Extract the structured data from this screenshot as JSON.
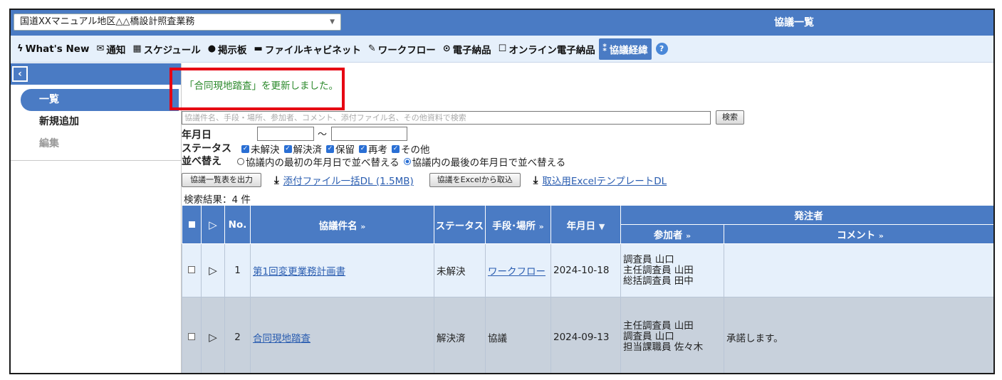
{
  "header": {
    "project_name": "国道XXマニュアル地区△△橋設計照査業務",
    "page_title": "協議一覧"
  },
  "menu": {
    "items": [
      {
        "label": "What's New",
        "icon": "bolt-icon",
        "glyph": "ϟ"
      },
      {
        "label": "通知",
        "icon": "mail-icon",
        "glyph": "✉"
      },
      {
        "label": "スケジュール",
        "icon": "calendar-icon",
        "glyph": "▦"
      },
      {
        "label": "掲示板",
        "icon": "chat-icon",
        "glyph": "●"
      },
      {
        "label": "ファイルキャビネット",
        "icon": "cabinet-icon",
        "glyph": "▬"
      },
      {
        "label": "ワークフロー",
        "icon": "edit-icon",
        "glyph": "✎"
      },
      {
        "label": "電子納品",
        "icon": "disc-icon",
        "glyph": "⊙"
      },
      {
        "label": "オンライン電子納品",
        "icon": "square-icon",
        "glyph": "☐"
      },
      {
        "label": "協議経緯",
        "icon": "people-icon",
        "glyph": "⁑",
        "active": true
      }
    ],
    "help": "?"
  },
  "sidebar": {
    "items": [
      {
        "label": "一覧",
        "state": "active"
      },
      {
        "label": "新規追加",
        "state": "normal"
      },
      {
        "label": "編集",
        "state": "disabled"
      }
    ]
  },
  "flash_message": "「合同現地踏査」を更新しました。",
  "search": {
    "placeholder": "協議件名、手段・場所、参加者、コメント、添付ファイル名、その他資料で検索",
    "button": "検索",
    "date_label": "年月日",
    "date_sep": "～",
    "status_label": "ステータス",
    "statuses": [
      "未解決",
      "解決済",
      "保留",
      "再考",
      "その他"
    ],
    "sort_label": "並べ替え",
    "sort_options": [
      {
        "label": "協議内の最初の年月日で並べ替える",
        "selected": false
      },
      {
        "label": "協議内の最後の年月日で並べ替える",
        "selected": true
      }
    ]
  },
  "actions": {
    "export_button": "協議一覧表を出力",
    "bulk_download": "添付ファイル一括DL (1.5MB)",
    "import_button": "協議をExcelから取込",
    "template_download": "取込用ExcelテンプレートDL"
  },
  "result_count": "検索結果：4 件",
  "table": {
    "headers": {
      "no": "No.",
      "title": "協議件名",
      "status": "ステータス",
      "method": "手段･場所",
      "date": "年月日",
      "orderer": "発注者",
      "participants": "参加者",
      "comment": "コメント"
    },
    "sort_more": "»",
    "sort_desc": "▼",
    "rows": [
      {
        "no": "1",
        "title": "第1回変更業務計画書",
        "status": "未解決",
        "method": "ワークフロー",
        "method_is_link": true,
        "date": "2024-10-18",
        "participants": [
          "調査員 山口",
          "主任調査員 山田",
          "総括調査員 田中"
        ],
        "comment": ""
      },
      {
        "no": "2",
        "title": "合同現地踏査",
        "status": "解決済",
        "method": "協議",
        "method_is_link": false,
        "date": "2024-09-13",
        "participants": [
          "主任調査員 山田",
          "調査員 山口",
          "担当課職員 佐々木"
        ],
        "comment": "承諾します。"
      }
    ]
  },
  "colors": {
    "accent": "#4a7bc4",
    "row_light": "#e6f0fb",
    "row_dark": "#c8d1dc",
    "highlight": "#e60012",
    "flash_text": "#2c8a2c"
  }
}
